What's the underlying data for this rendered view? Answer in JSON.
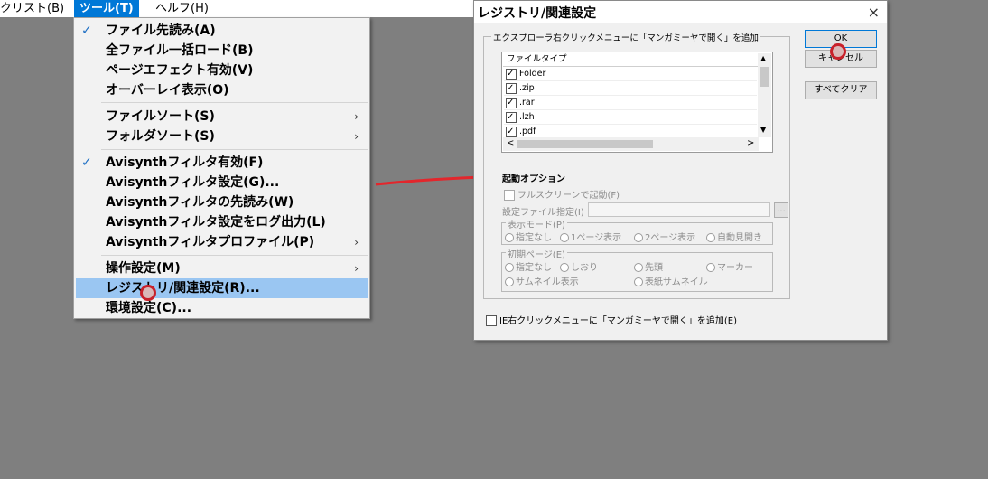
{
  "menubar": {
    "items": [
      {
        "label": "クリスト(B)",
        "active": false
      },
      {
        "label": "ツール(T)",
        "active": true
      },
      {
        "label": "ヘルフ(H)",
        "active": false
      }
    ]
  },
  "tools_menu": {
    "items": [
      {
        "label": "ファイル先読み(A)",
        "checked": true
      },
      {
        "label": "全ファイル一括ロード(B)"
      },
      {
        "label": "ページエフェクト有効(V)"
      },
      {
        "label": "オーバーレイ表示(O)"
      },
      {
        "label": "ファイルソート(S)",
        "submenu": true
      },
      {
        "label": "フォルダソート(S)",
        "submenu": true
      },
      {
        "label": "Avisynthフィルタ有効(F)",
        "checked": true
      },
      {
        "label": "Avisynthフィルタ設定(G)..."
      },
      {
        "label": "Avisynthフィルタの先読み(W)"
      },
      {
        "label": "Avisynthフィルタ設定をログ出力(L)"
      },
      {
        "label": "Avisynthフィルタプロファイル(P)",
        "submenu": true
      },
      {
        "label": "操作設定(M)",
        "submenu": true
      },
      {
        "label": "レジストリ/関連設定(R)...",
        "highlighted": true
      },
      {
        "label": "環境設定(C)..."
      }
    ],
    "check_glyph": "✓",
    "submenu_glyph": "›"
  },
  "dialog": {
    "title": "レジストリ/関連設定",
    "close_glyph": "×",
    "explorer_group": "エクスプローラ右クリックメニューに「マンガミーヤで開く」を追加",
    "file_type_header": "ファイルタイプ",
    "file_types": [
      {
        "label": "Folder",
        "checked": true
      },
      {
        "label": ".zip",
        "checked": true
      },
      {
        "label": ".rar",
        "checked": true
      },
      {
        "label": ".lzh",
        "checked": true
      },
      {
        "label": ".pdf",
        "checked": true
      }
    ],
    "ok_label": "OK",
    "cancel_label": "キャンセル",
    "clear_all_label": "すべてクリア",
    "launch_options_title": "起動オプション",
    "fullscreen_label": "フルスクリーンで起動(F)",
    "config_file_label": "設定ファイル指定(I)",
    "browse_label": "...",
    "display_mode_group": "表示モード(P)",
    "display_modes": [
      "指定なし",
      "1ページ表示",
      "2ページ表示",
      "自動見開き"
    ],
    "initial_page_group": "初期ページ(E)",
    "initial_pages": [
      "指定なし",
      "しおり",
      "先頭",
      "マーカー",
      "サムネイル表示",
      "表紙サムネイル"
    ],
    "ie_label": "IE右クリックメニューに「マンガミーヤで開く」を追加(E)",
    "ie_checked": false
  },
  "colors": {
    "highlight": "#9ac6f2",
    "menu_accent": "#0078d7",
    "annotation_arrow": "#e3262c"
  },
  "icons": {
    "scroll_up": "▲",
    "scroll_down": "▼",
    "scroll_left": "<",
    "scroll_right": ">"
  }
}
